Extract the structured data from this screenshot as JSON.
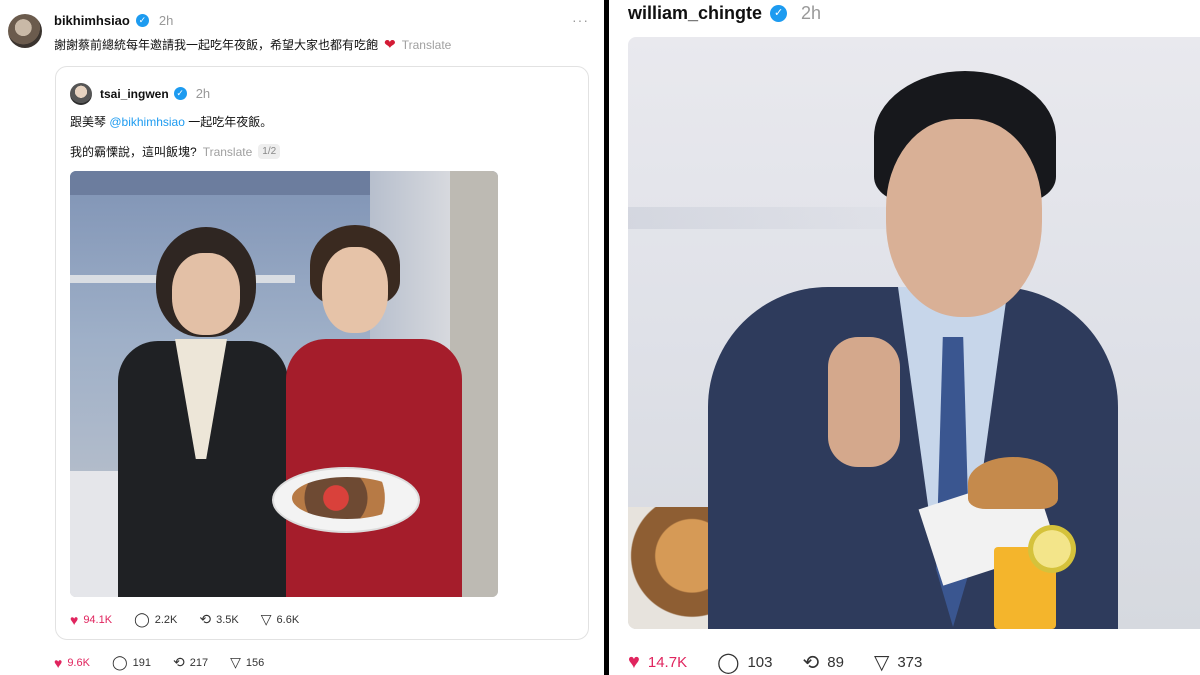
{
  "left_post": {
    "username": "bikhimhsiao",
    "time": "2h",
    "more": "···",
    "text": "謝謝蔡前總統每年邀請我一起吃年夜飯，希望大家也都有吃飽",
    "heart": "❤",
    "translate": "Translate",
    "quote": {
      "username": "tsai_ingwen",
      "time": "2h",
      "line1_prefix": "跟美琴 ",
      "mention": "@bikhimhsiao",
      "line1_suffix": " 一起吃年夜飯。",
      "line2": "我的霸慄說，這叫飯塊?",
      "translate": "Translate",
      "pager": "1/2",
      "actions": {
        "likes": "94.1K",
        "comments": "2.2K",
        "reposts": "3.5K",
        "shares": "6.6K"
      }
    },
    "actions": {
      "likes": "9.6K",
      "comments": "191",
      "reposts": "217",
      "shares": "156"
    }
  },
  "right_post": {
    "username": "william_chingte",
    "time": "2h",
    "actions": {
      "likes": "14.7K",
      "comments": "103",
      "reposts": "89",
      "shares": "373"
    }
  },
  "icons": {
    "verified": "✓",
    "heart": "♥",
    "comment": "◯",
    "repost": "⟲",
    "share": "▽"
  },
  "colors": {
    "like": "#e0245e",
    "verified": "#1d9bf0",
    "mention": "#1d9bf0"
  }
}
